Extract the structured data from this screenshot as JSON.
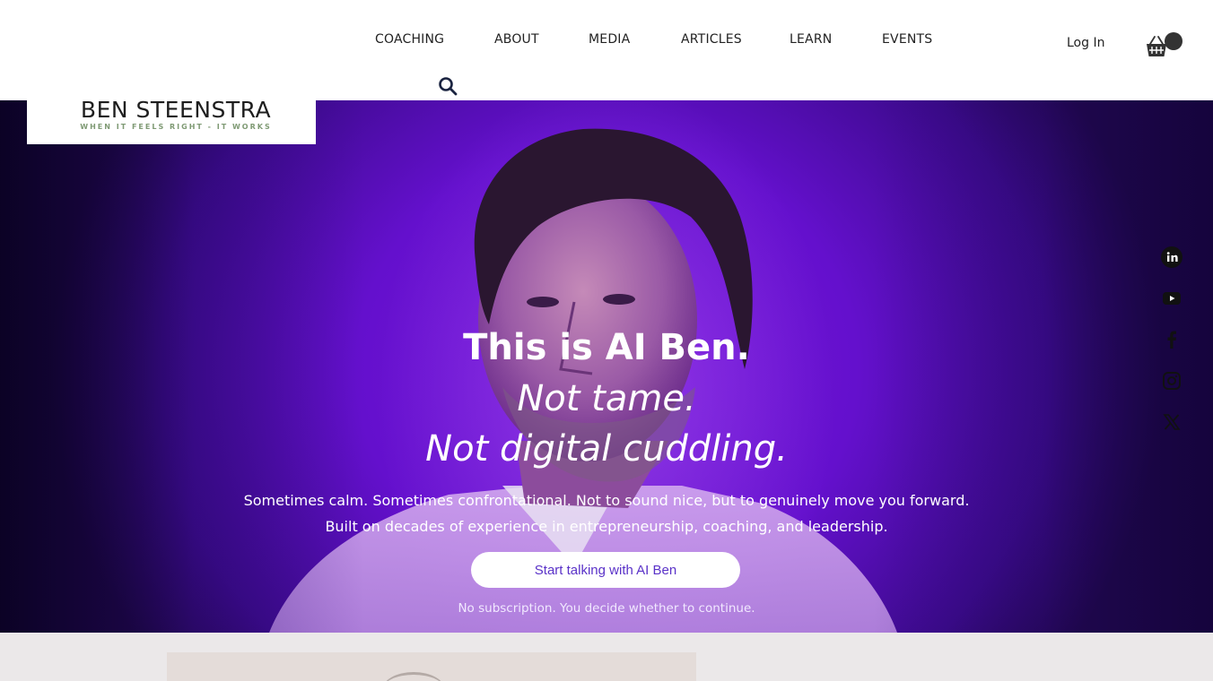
{
  "brand": {
    "name": "BEN STEENSTRA",
    "tagline": "WHEN IT FEELS RIGHT - IT WORKS"
  },
  "nav": {
    "items": [
      {
        "label": "COACHING"
      },
      {
        "label": "ABOUT"
      },
      {
        "label": "MEDIA"
      },
      {
        "label": "ARTICLES"
      },
      {
        "label": "LEARN"
      },
      {
        "label": "EVENTS"
      }
    ],
    "search_icon": "search-icon",
    "login_label": "Log In",
    "cart_icon": "basket-icon"
  },
  "hero": {
    "title": "This is AI Ben.",
    "line1": "Not tame.",
    "line2": "Not digital cuddling.",
    "body1": "Sometimes calm. Sometimes confrontational. Not to sound nice, but to genuinely move you forward.",
    "body2": "Built on decades of experience in entrepreneurship, coaching, and leadership.",
    "cta_label": "Start talking with AI Ben",
    "note": "No subscription. You decide whether to continue."
  },
  "social": [
    {
      "icon": "linkedin-icon"
    },
    {
      "icon": "youtube-icon"
    },
    {
      "icon": "facebook-icon"
    },
    {
      "icon": "instagram-icon"
    },
    {
      "icon": "x-icon"
    }
  ],
  "colors": {
    "hero_purple": "#6410cd",
    "cta_text": "#5a32c8",
    "tagline": "#7f9a74",
    "section_bg": "#ebe8e9"
  }
}
